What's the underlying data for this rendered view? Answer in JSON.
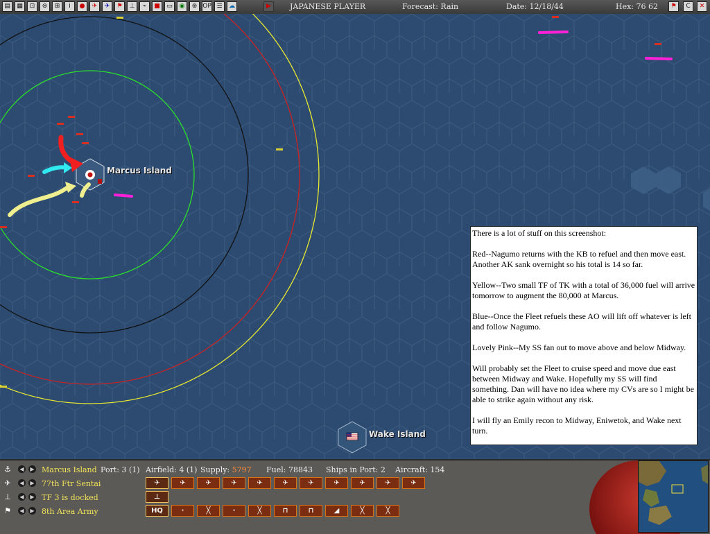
{
  "topbar": {
    "player": "JAPANESE PLAYER",
    "forecast": "Forecast: Rain",
    "date": "Date: 12/18/44",
    "hex": "Hex: 76 62",
    "op_label": "OP",
    "corner_c_label": "C",
    "corner_x_label": "✕",
    "toolbar_icons": [
      "save-icon",
      "report-icon",
      "tf-icon",
      "sub-icon",
      "info-icon",
      "japan-flag-icon",
      "air-icon",
      "fighter-icon",
      "flag-icon",
      "ship-icon",
      "group-icon",
      "mission-icon",
      "base-icon",
      "globe-icon",
      "filter-icon",
      "op-icon",
      "list-icon",
      "cloud-icon",
      "play-icon"
    ]
  },
  "map": {
    "marcus_label": "Marcus Island",
    "wake_label": "Wake Island",
    "range_colors": {
      "inner": "#2adf2a",
      "black": "#111111",
      "red": "#cc2222",
      "yellow": "#e8e830"
    },
    "arrow_colors": {
      "red": "#f02020",
      "cyan": "#30e8f0",
      "yellow": "#f0ef90",
      "pink": "#ff20d8"
    }
  },
  "note": {
    "paragraphs": [
      "There is a lot of stuff on this screenshot:",
      "Red--Nagumo returns with the KB to refuel and then move east.  Another AK sank overnight so his total is 14 so far.",
      "Yellow--Two small TF of TK with a total of 36,000 fuel will arrive tomorrow to augment the 80,000 at Marcus.",
      "Blue--Once the Fleet refuels these AO will lift off whatever is left and follow Nagumo.",
      "Lovely Pink--My SS fan out to move above and below Midway.",
      "Will probably set the Fleet to cruise speed and move due east between Midway and Wake.  Hopefully my SS will find something.  Dan will have no idea where my CVs are so I might be able to strike again without any risk.",
      "I will fly an Emily recon to Midway, Eniwetok, and Wake next turn."
    ]
  },
  "panel": {
    "base_name": "Marcus Island",
    "port": "Port: 3 (1)",
    "airfield": "Airfield: 4 (1)",
    "supply_label": "Supply:",
    "supply_value": "5797",
    "fuel": "Fuel: 78843",
    "ships_in_port": "Ships in Port: 2",
    "aircraft": "Aircraft: 154",
    "air_unit": "77th Ftr Sentai",
    "tf_status": "TF 3 is docked",
    "land_unit": "8th Area Army",
    "hq_label": "HQ",
    "aircraft_icons": 11,
    "unit_symbols": [
      "HQ",
      "·",
      "╳",
      "·",
      "╳",
      "⊓",
      "⊓",
      "◢",
      "╳",
      "╳"
    ]
  }
}
